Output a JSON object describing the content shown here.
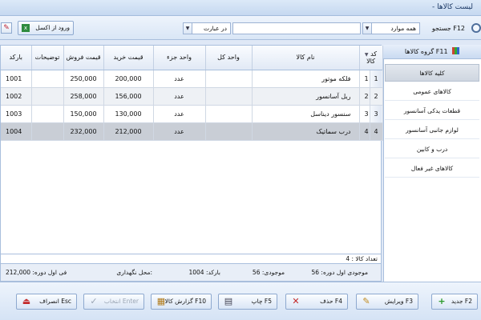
{
  "window": {
    "title": "- لیست کالاها"
  },
  "toolbar": {
    "search_label": "جستجو F12",
    "scope_value": "همه موارد",
    "mode_value": "در عبارت",
    "search_value": "",
    "import_label": "ورود از اکسل"
  },
  "categories": {
    "header": "گروه کالاها F11",
    "items": [
      "کلیه کالاها",
      "کالاهای عمومی",
      "قطعات یدکی آسانسور",
      "لوازم جانبی آسانسور",
      "درب و کابین",
      "کالاهای غیر فعال"
    ],
    "active_index": 0
  },
  "table": {
    "headers": {
      "code": "کد کالا",
      "name": "نام کالا",
      "unit_total": "واحد کل",
      "unit_part": "واحد جزء",
      "buy_price": "قیمت خرید",
      "sell_price": "قیمت فروش",
      "notes": "توضیحات",
      "barcode": "بارکد"
    },
    "rows": [
      {
        "row_no": "1",
        "code": "1",
        "name": "فلکه موتور",
        "unit_total": "",
        "unit_part": "عدد",
        "buy_price": "200,000",
        "sell_price": "250,000",
        "notes": "",
        "barcode": "1001",
        "marker": ""
      },
      {
        "row_no": "2",
        "code": "2",
        "name": "ریل آسانسور",
        "unit_total": "",
        "unit_part": "عدد",
        "buy_price": "156,000",
        "sell_price": "258,000",
        "notes": "",
        "barcode": "1002",
        "marker": ""
      },
      {
        "row_no": "3",
        "code": "3",
        "name": "سنسور دیناسل",
        "unit_total": "",
        "unit_part": "عدد",
        "buy_price": "130,000",
        "sell_price": "150,000",
        "notes": "",
        "barcode": "1003",
        "marker": ""
      },
      {
        "row_no": "4",
        "code": "4",
        "name": "درب سماتیک",
        "unit_total": "",
        "unit_part": "عدد",
        "buy_price": "212,000",
        "sell_price": "232,000",
        "notes": "",
        "barcode": "1004",
        "marker": "◂"
      }
    ],
    "selected_index": 3
  },
  "status": {
    "count_label": "تعداد کالا : 4"
  },
  "info": {
    "stock_initial": "موجودی اول دوره: 56",
    "stock": "موجودی: 56",
    "barcode": "بارکد: 1004",
    "location": "محل نگهداری:",
    "price_initial": "فی اول دوره: 212,000"
  },
  "actions": {
    "new": "جدید F2",
    "edit": "ویرایش F3",
    "delete": "حذف F4",
    "print": "چاپ F5",
    "report": "گزارش کالا F10",
    "select": "انتخاب Enter",
    "cancel": "انصراف Esc"
  }
}
